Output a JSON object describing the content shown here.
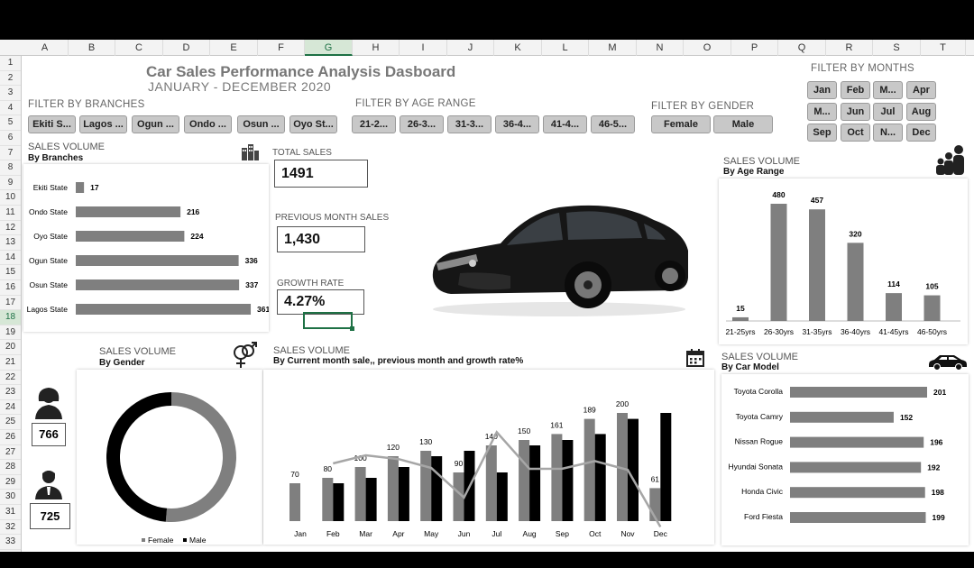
{
  "columns": [
    "A",
    "B",
    "C",
    "D",
    "E",
    "F",
    "G",
    "H",
    "I",
    "J",
    "K",
    "L",
    "M",
    "N",
    "O",
    "P",
    "Q",
    "R",
    "S",
    "T"
  ],
  "rows": [
    "1",
    "2",
    "3",
    "4",
    "5",
    "6",
    "7",
    "8",
    "9",
    "10",
    "11",
    "12",
    "13",
    "14",
    "15",
    "16",
    "17",
    "18",
    "19",
    "20",
    "21",
    "22",
    "23",
    "24",
    "25",
    "26",
    "27",
    "28",
    "29",
    "30",
    "31",
    "32",
    "33"
  ],
  "dashboard": {
    "title": "Car Sales Performance Analysis Dasboard",
    "subtitle": "JANUARY - DECEMBER 2020"
  },
  "filters": {
    "branches": {
      "label": "FILTER BY BRANCHES",
      "items": [
        "Ekiti S...",
        "Lagos ...",
        "Ogun ...",
        "Ondo ...",
        "Osun ...",
        "Oyo St..."
      ]
    },
    "age": {
      "label": "FILTER BY AGE RANGE",
      "items": [
        "21-2...",
        "26-3...",
        "31-3...",
        "36-4...",
        "41-4...",
        "46-5..."
      ]
    },
    "gender": {
      "label": "FILTER BY GENDER",
      "items": [
        "Female",
        "Male"
      ]
    },
    "months": {
      "label": "FILTER BY MONTHS",
      "items": [
        "Jan",
        "Feb",
        "M...",
        "Apr",
        "M...",
        "Jun",
        "Jul",
        "Aug",
        "Sep",
        "Oct",
        "N...",
        "Dec"
      ]
    }
  },
  "kpis": {
    "total_sales": {
      "label": "TOTAL SALES",
      "value": "1491"
    },
    "prev_month": {
      "label": "PREVIOUS MONTH SALES",
      "value": "1,430"
    },
    "growth": {
      "label": "GROWTH RATE",
      "value": "4.27%"
    }
  },
  "sections": {
    "branches": {
      "title": "SALES VOLUME",
      "sub": "By Branches"
    },
    "age": {
      "title": "SALES VOLUME",
      "sub": "By Age Range"
    },
    "gender": {
      "title": "SALES VOLUME",
      "sub": "By Gender"
    },
    "monthly": {
      "title": "SALES VOLUME",
      "sub": "By Current month sale,, previous month and growth rate%"
    },
    "model": {
      "title": "SALES VOLUME",
      "sub": "By Car Model"
    }
  },
  "gender_counts": {
    "female": "766",
    "male": "725"
  },
  "colors": {
    "grey_bar": "#7f7f7f",
    "black_bar": "#000000",
    "line": "#a6a6a6",
    "excel_green": "#1e7145"
  },
  "chart_data": [
    {
      "type": "bar",
      "orientation": "horizontal",
      "categories": [
        "Ekiti State",
        "Ondo State",
        "Oyo State",
        "Ogun State",
        "Osun State",
        "Lagos State"
      ],
      "values": [
        17,
        216,
        224,
        336,
        337,
        361
      ]
    },
    {
      "type": "bar",
      "categories": [
        "21-25yrs",
        "26-30yrs",
        "31-35yrs",
        "36-40yrs",
        "41-45yrs",
        "46-50yrs"
      ],
      "values": [
        15,
        480,
        457,
        320,
        114,
        105
      ]
    },
    {
      "type": "pie",
      "variant": "doughnut",
      "categories": [
        "Female",
        "Male"
      ],
      "values": [
        766,
        725
      ]
    },
    {
      "type": "bar",
      "categories": [
        "Jan",
        "Feb",
        "Mar",
        "Apr",
        "May",
        "Jun",
        "Jul",
        "Aug",
        "Sep",
        "Oct",
        "Nov",
        "Dec"
      ],
      "series": [
        {
          "name": "current",
          "values": [
            70,
            80,
            100,
            120,
            130,
            90,
            140,
            150,
            161,
            189,
            200,
            61
          ]
        },
        {
          "name": "previous",
          "values": [
            null,
            70,
            80,
            100,
            120,
            130,
            90,
            140,
            150,
            161,
            189,
            200
          ]
        },
        {
          "name": "growth",
          "type": "line",
          "values": [
            null,
            14.3,
            25.0,
            20.0,
            8.3,
            -30.8,
            55.6,
            7.1,
            7.3,
            17.4,
            5.8,
            -69.5
          ]
        }
      ],
      "data_labels": [
        "70",
        "80",
        "100",
        "120",
        "130",
        "90",
        "140",
        "150",
        "161",
        "189",
        "200",
        "61"
      ]
    },
    {
      "type": "bar",
      "orientation": "horizontal",
      "categories": [
        "Toyota Corolla",
        "Toyota Camry",
        "Nissan Rogue",
        "Hyundai Sonata",
        "Honda Civic",
        "Ford Fiesta"
      ],
      "values": [
        201,
        152,
        196,
        192,
        198,
        199
      ]
    }
  ]
}
